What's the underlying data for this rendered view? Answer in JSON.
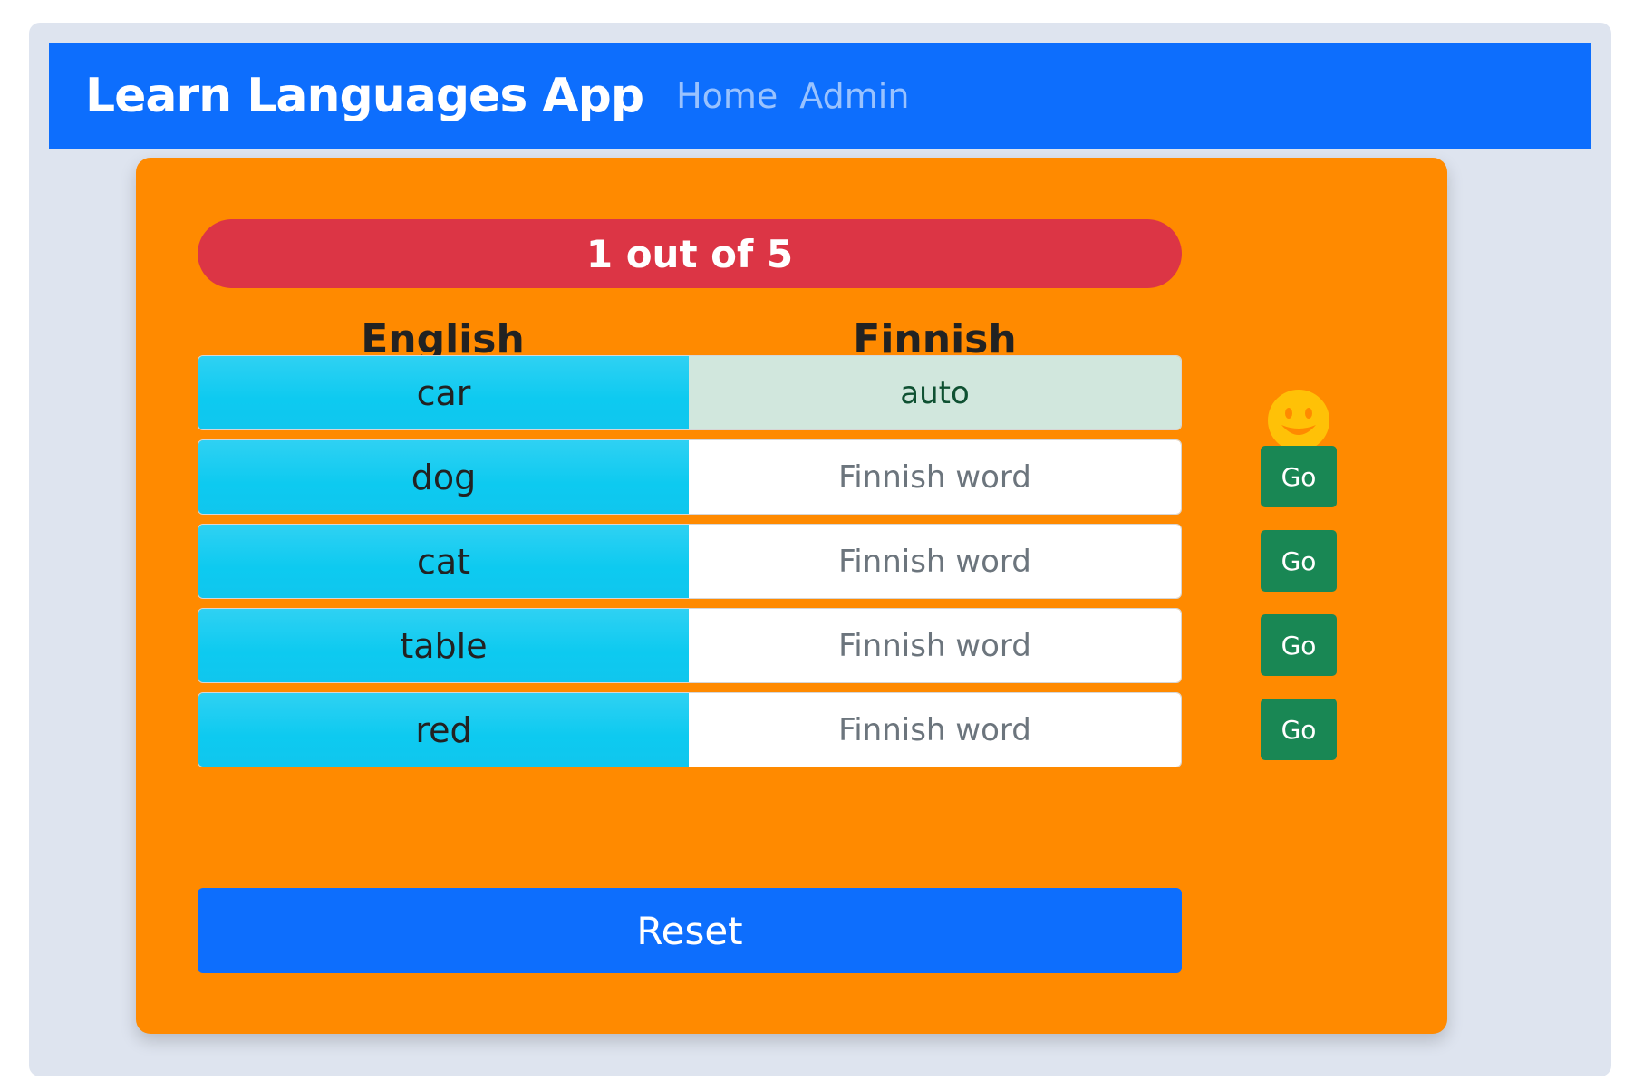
{
  "navbar": {
    "brand": "Learn Languages App",
    "links": [
      "Home",
      "Admin"
    ]
  },
  "quiz": {
    "progress": "1 out of 5",
    "columns": {
      "english": "English",
      "finnish": "Finnish"
    },
    "rows": [
      {
        "english": "car",
        "finnish_value": "auto",
        "answered": true,
        "status_icon": "smiley-face-icon"
      },
      {
        "english": "dog",
        "finnish_placeholder": "Finnish word",
        "button": "Go"
      },
      {
        "english": "cat",
        "finnish_placeholder": "Finnish word",
        "button": "Go"
      },
      {
        "english": "table",
        "finnish_placeholder": "Finnish word",
        "button": "Go"
      },
      {
        "english": "red",
        "finnish_placeholder": "Finnish word",
        "button": "Go"
      }
    ],
    "reset_label": "Reset"
  },
  "colors": {
    "navbar": "#0d6efd",
    "card": "#ff8a00",
    "progress": "#dc3545",
    "english_cell": "#0dcaf0",
    "correct_cell": "#d1e7dd",
    "go_button": "#198754",
    "reset_button": "#0d6efd"
  }
}
